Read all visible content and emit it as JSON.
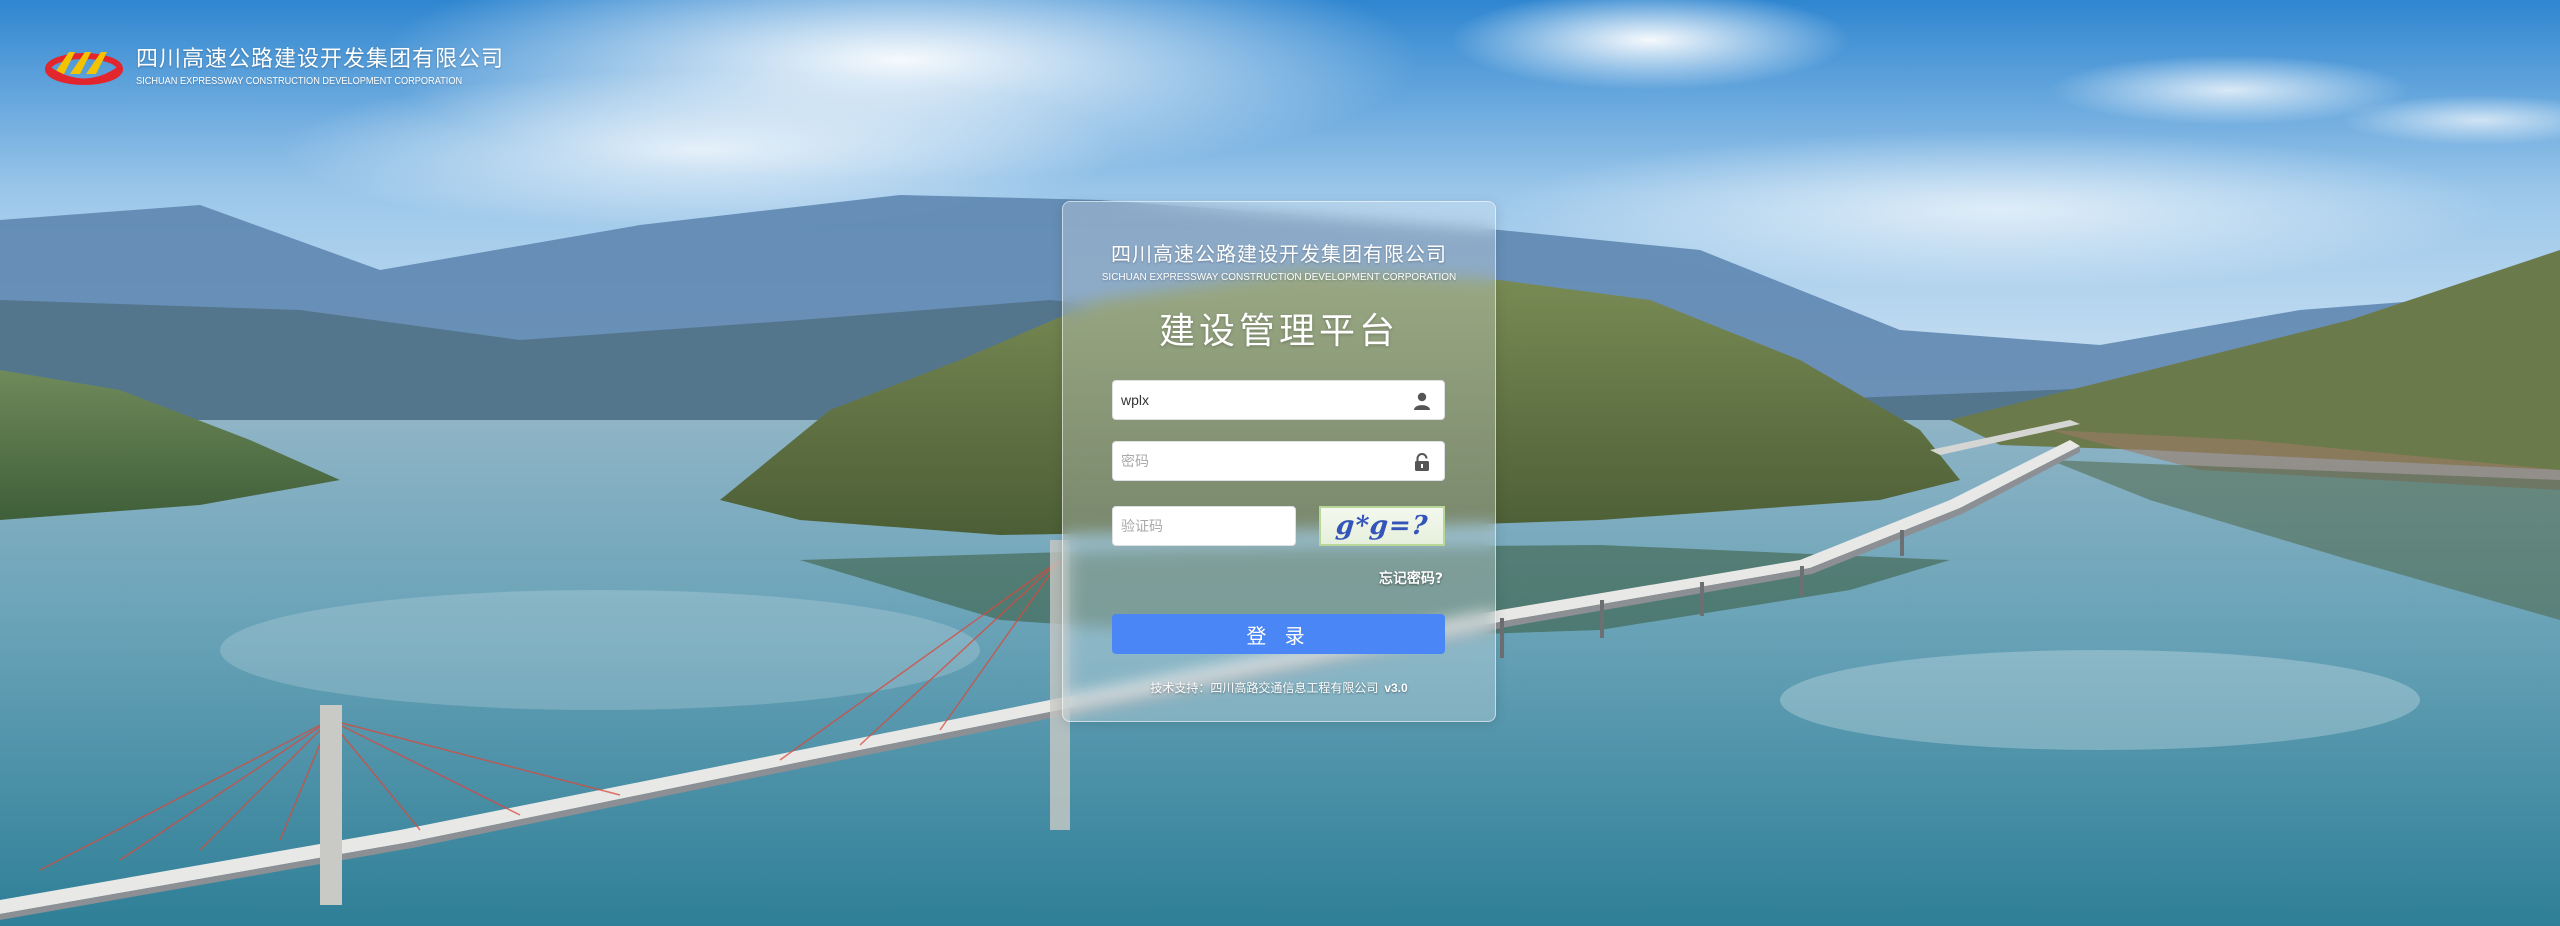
{
  "brand": {
    "logo_icon": "company-logo-icon",
    "name_cn": "四川高速公路建设开发集团有限公司",
    "name_en": "SICHUAN EXPRESSWAY CONSTRUCTION DEVELOPMENT CORPORATION"
  },
  "login_panel": {
    "company_cn": "四川高速公路建设开发集团有限公司",
    "company_en": "SICHUAN EXPRESSWAY CONSTRUCTION DEVELOPMENT CORPORATION",
    "title": "建设管理平台",
    "username": {
      "value": "wplx",
      "placeholder": "",
      "icon": "user-icon"
    },
    "password": {
      "value": "",
      "placeholder": "密码",
      "icon": "lock-icon"
    },
    "captcha": {
      "value": "",
      "placeholder": "验证码",
      "image_text": "g*g=?"
    },
    "forgot_password": "忘记密码?",
    "login_button": "登 录",
    "support_text": "技术支持：四川高路交通信息工程有限公司",
    "version": "v3.0"
  },
  "colors": {
    "login_button": "#4a86f5",
    "panel_bg": "rgba(230,236,240,0.30)",
    "text_light": "#ffffff"
  }
}
